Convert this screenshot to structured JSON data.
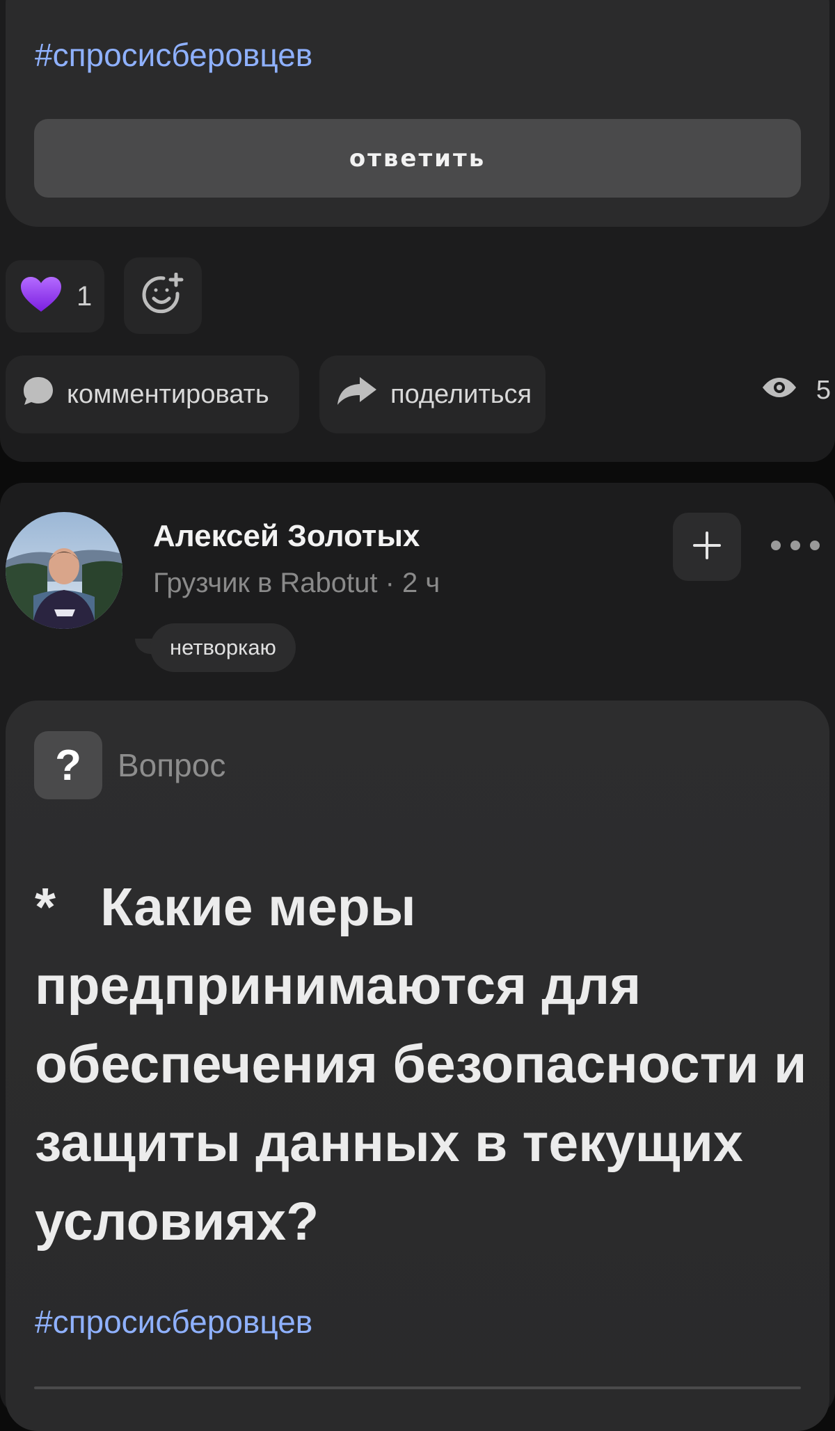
{
  "top_post": {
    "hashtag": "#спросисберовцев",
    "answer_button": "ответить",
    "reaction": {
      "emoji": "purple-heart-icon",
      "count": "1"
    },
    "comment_label": "комментировать",
    "share_label": "поделиться",
    "views_count": "5"
  },
  "post": {
    "author": {
      "name": "Алексей Золотых",
      "subtitle": "Грузчик в Rabotut · 2 ч",
      "status": "нетворкаю"
    },
    "type_label": "Вопрос",
    "type_icon_text": "?",
    "question": "*   Какие меры предпринимаются для обеспечения безопасности и защиты данных в текущих условиях?",
    "hashtag": "#спросисберовцев"
  },
  "colors": {
    "background": "#0b0b0b",
    "card": "#1c1c1d",
    "question_card": "#2b2b2c",
    "hashtag": "#8fb1ff",
    "heart": "#a855f7"
  }
}
